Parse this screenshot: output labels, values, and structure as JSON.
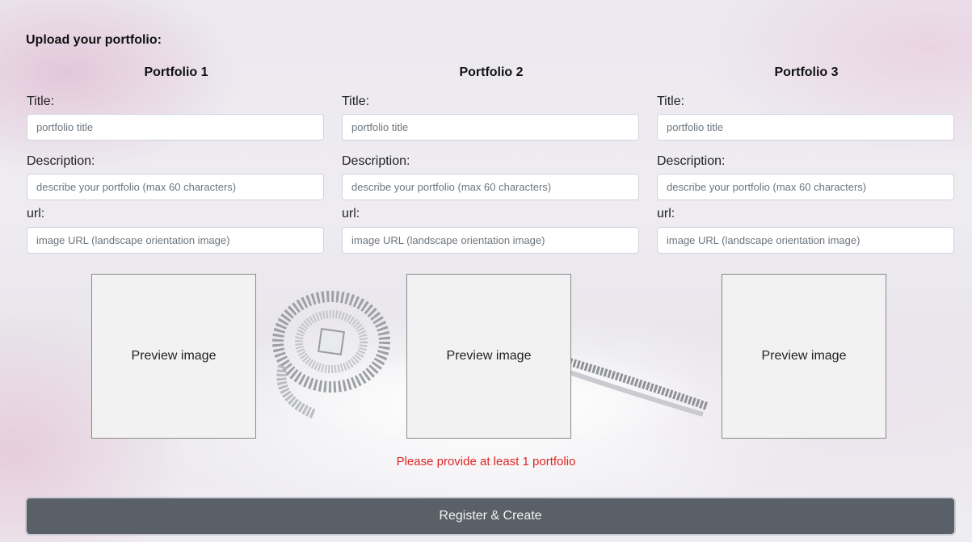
{
  "form": {
    "heading": "Upload your portfolio:",
    "portfolios": [
      {
        "title": "Portfolio 1",
        "title_label": "Title:",
        "title_placeholder": "portfolio title",
        "description_label": "Description:",
        "description_placeholder": "describe your portfolio (max 60 characters)",
        "url_label": "url:",
        "url_placeholder": "image URL (landscape orientation image)",
        "preview_text": "Preview image"
      },
      {
        "title": "Portfolio 2",
        "title_label": "Title:",
        "title_placeholder": "portfolio title",
        "description_label": "Description:",
        "description_placeholder": "describe your portfolio (max 60 characters)",
        "url_label": "url:",
        "url_placeholder": "image URL (landscape orientation image)",
        "preview_text": "Preview image"
      },
      {
        "title": "Portfolio 3",
        "title_label": "Title:",
        "title_placeholder": "portfolio title",
        "description_label": "Description:",
        "description_placeholder": "describe your portfolio (max 60 characters)",
        "url_label": "url:",
        "url_placeholder": "image URL (landscape orientation image)",
        "preview_text": "Preview image"
      }
    ],
    "error_message": "Please provide at least 1 portfolio",
    "submit_label": "Register & Create"
  },
  "colors": {
    "error": "#e02424",
    "button": "#5a6068"
  },
  "background_image": "wedding-rings-photo"
}
